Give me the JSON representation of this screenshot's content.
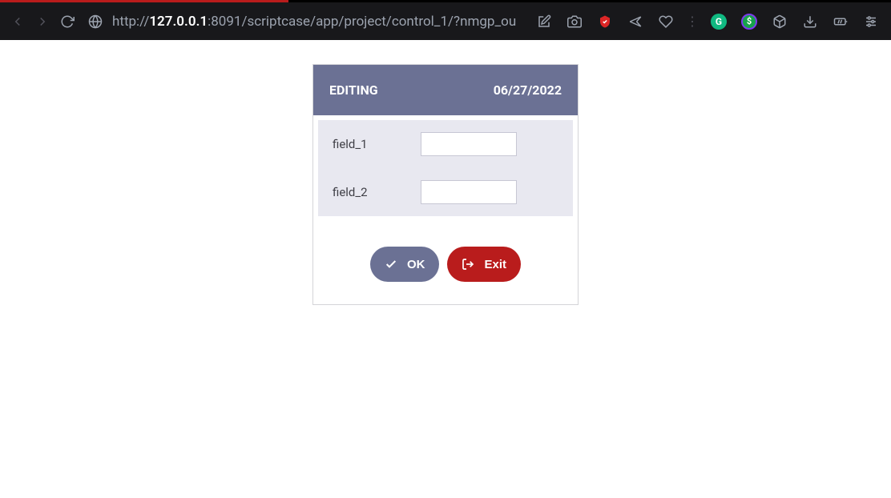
{
  "browser": {
    "url_prefix": "http://",
    "url_host": "127.0.0.1",
    "url_port_path": ":8091/scriptcase/app/project/control_1/?nmgp_ou"
  },
  "toolbar": {
    "grammarly_label": "G",
    "dollar_label": "$"
  },
  "form": {
    "header_title": "EDITING",
    "header_date": "06/27/2022",
    "fields": [
      {
        "label": "field_1",
        "value": ""
      },
      {
        "label": "field_2",
        "value": ""
      }
    ],
    "ok_label": "OK",
    "exit_label": "Exit"
  }
}
